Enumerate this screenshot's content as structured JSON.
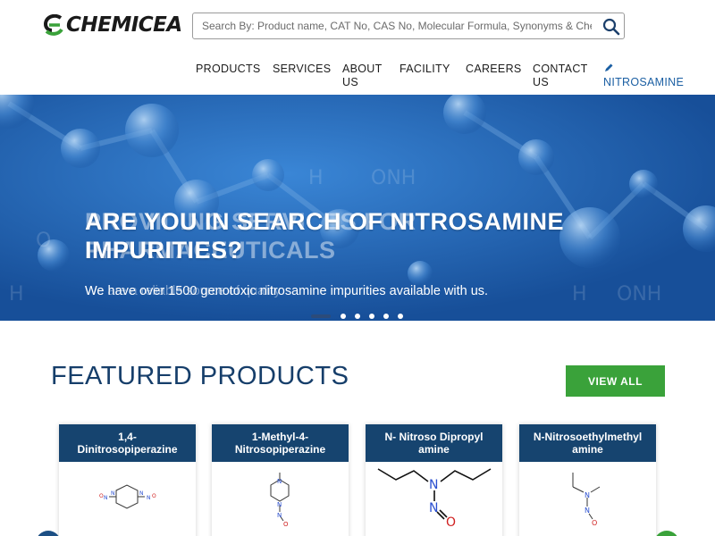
{
  "brand": {
    "logo_text": "CHEMICEA"
  },
  "search": {
    "placeholder": "Search By: Product name, CAT No, CAS No, Molecular Formula, Synonyms & Chemical Name"
  },
  "nav": {
    "products": "PRODUCTS",
    "services": "SERVICES",
    "about_1": "ABOUT",
    "about_2": "US",
    "facility": "FACILITY",
    "careers": "CAREERS",
    "contact_1": "CONTACT",
    "contact_2": "US",
    "nitrosamine": "NITROSAMINE"
  },
  "hero": {
    "title_line1": "ARE YOU IN SEARCH OF NITROSAMINE",
    "title_line2": "IMPURITIES?",
    "ghost_line1": "PROVIDING SERVICES FOR",
    "ghost_line2": "PHARMACEUTICALS",
    "subtitle": "We have over 1500 genotoxic nitrosamine impurities available with us.",
    "ghost_subtitle": "We are a reliable source of quality",
    "slides_total": 6,
    "active_slide": 1
  },
  "featured": {
    "title": "FEATURED PRODUCTS",
    "view_all": "VIEW ALL",
    "products": [
      {
        "line1": "1,4-",
        "line2": "Dinitrosopiperazine"
      },
      {
        "line1": "1-Methyl-4-",
        "line2": "Nitrosopiperazine"
      },
      {
        "line1": "N- Nitroso Dipropyl",
        "line2": "amine"
      },
      {
        "line1": "N-Nitrosoethylmethyl",
        "line2": "amine"
      }
    ]
  },
  "colors": {
    "hero_blue": "#1d5fb3",
    "navy": "#16446f",
    "green": "#3aa23a",
    "accent": "#1b5fa3"
  }
}
